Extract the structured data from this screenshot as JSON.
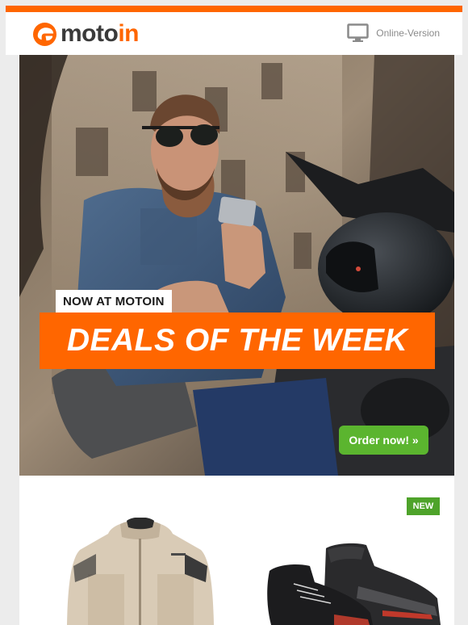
{
  "brand": {
    "name_part1": "moto",
    "name_part2": "in",
    "accent": "#ff6600",
    "dark": "#3a3a3a"
  },
  "header": {
    "online_version_label": "Online-Version",
    "online_icon": "monitor-icon"
  },
  "hero": {
    "eyebrow": "NOW AT MOTOIN",
    "headline": "DEALS OF THE WEEK",
    "cta_label": "Order now! »",
    "cta_color": "#5bb52f"
  },
  "products": {
    "badge_label": "NEW",
    "badge_color": "#4ea32a",
    "items": [
      {
        "image": "textile-motorcycle-jacket-beige"
      },
      {
        "image": "motorcycle-riding-shoes-black"
      }
    ]
  }
}
